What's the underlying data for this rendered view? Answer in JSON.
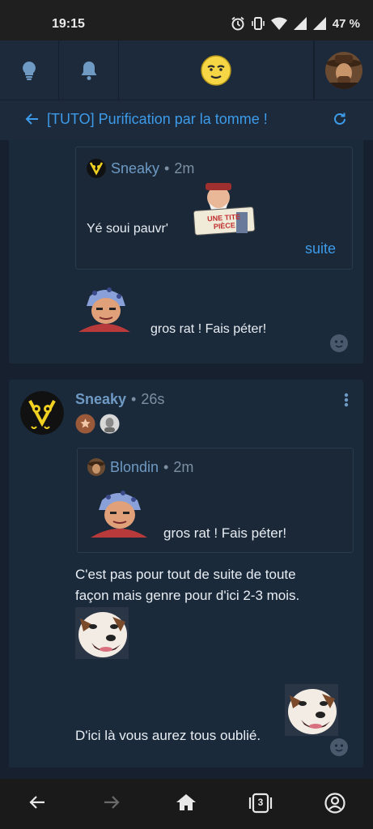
{
  "status_bar": {
    "time": "19:15",
    "battery": "47 %"
  },
  "topic": {
    "title": "[TUTO] Purification par la tomme !"
  },
  "posts": [
    {
      "quote": {
        "author": "Sneaky",
        "time": "2m",
        "text": "Yé soui pauvr'",
        "more_link": "suite",
        "sticker_text": "UNE TITE PIÈCE"
      },
      "text": "gros rat ! Fais péter!"
    },
    {
      "author": "Sneaky",
      "time": "26s",
      "quote": {
        "author": "Blondin",
        "time": "2m",
        "text": "gros rat ! Fais péter!"
      },
      "body_line1": "C'est pas pour tout de suite de toute",
      "body_line2": "façon mais genre pour d'ici 2-3 mois.",
      "body_line3": "D'ici là vous aurez tous oublié."
    }
  ],
  "bottom_nav": {
    "tabs_count": "3"
  },
  "colors": {
    "accent": "#3d9be9",
    "card": "#1b2a3b",
    "background": "#16202e"
  },
  "icons": [
    "lightbulb-icon",
    "bell-icon",
    "smiley-logo-icon",
    "back-arrow-icon",
    "refresh-icon",
    "kebab-icon",
    "reaction-icon",
    "home-icon",
    "tabs-icon",
    "account-icon"
  ]
}
